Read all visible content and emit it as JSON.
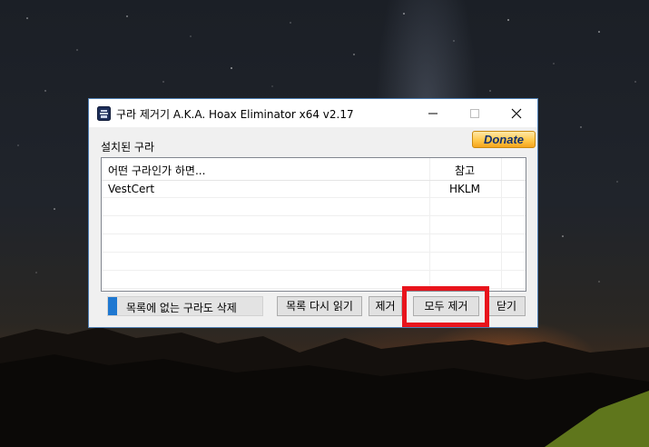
{
  "window": {
    "title": "구라 제거기 A.K.A. Hoax Eliminator x64 v2.17",
    "controls": [
      "minimize-icon",
      "maximize-icon",
      "close-icon"
    ]
  },
  "section_label": "설치된 구라",
  "donate_label": "Donate",
  "list": {
    "headers": {
      "name": "어떤 구라인가 하면...",
      "ref": "참고"
    },
    "rows": [
      {
        "name": "VestCert",
        "ref": "HKLM"
      }
    ]
  },
  "buttons": {
    "delete_unlisted": "목록에 없는 구라도 삭제",
    "reread_list": "목록 다시 읽기",
    "remove": "제거",
    "remove_all": "모두 제거",
    "close": "닫기"
  },
  "colors": {
    "highlight": "#e8141c",
    "accent": "#1f78d1",
    "window_border": "#4f7fb4"
  }
}
